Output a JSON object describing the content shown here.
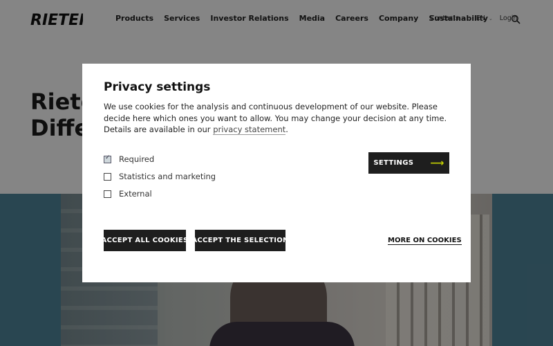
{
  "header": {
    "brand": "RIETER",
    "nav": [
      "Products",
      "Services",
      "Investor Relations",
      "Media",
      "Careers",
      "Company",
      "Sustainability"
    ],
    "contacts": "Contacts",
    "language": "EN",
    "login": "Login",
    "icons": {
      "search": "search-icon",
      "chevron": "chevron-down-icon"
    }
  },
  "hero": {
    "title_line1": "Riete",
    "title_line2": "Differ"
  },
  "modal": {
    "title": "Privacy settings",
    "text_before_link": "We use cookies for the analysis and continuous development of our website. Please decide here which ones you want to allow. You may change your decision at any time. Details are available in our ",
    "link_text": "privacy statement",
    "text_after_link": ".",
    "checkboxes": [
      {
        "label": "Required",
        "checked": true
      },
      {
        "label": "Statistics and marketing",
        "checked": false
      },
      {
        "label": "External",
        "checked": false
      }
    ],
    "settings_label": "SETTINGS",
    "accept_all_label": "ACCEPT ALL COOKIES",
    "accept_selection_label": "ACCEPT THE SELECTION",
    "more_label": "MORE ON COOKIES"
  },
  "colors": {
    "accent_arrow": "#c8d400",
    "button_dark": "#1e1e1e",
    "band": "#4c8094"
  }
}
